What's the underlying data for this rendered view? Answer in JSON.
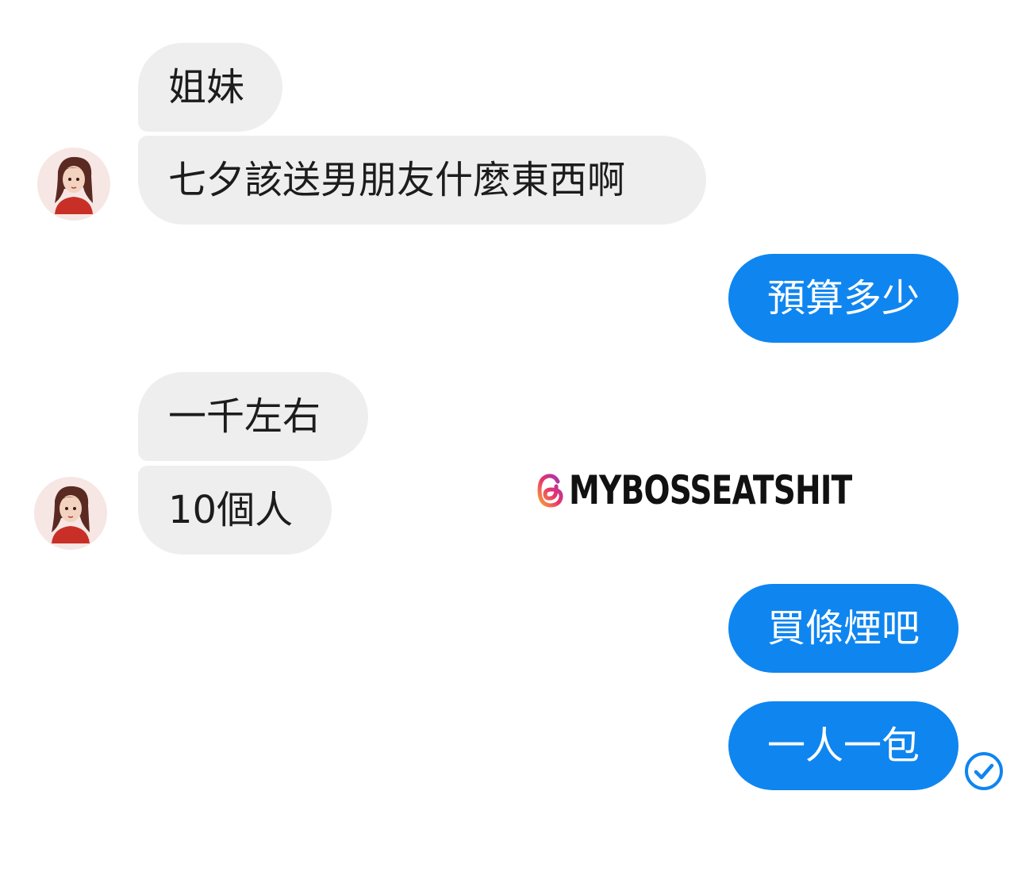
{
  "messages": [
    {
      "side": "incoming",
      "text": "姐妹"
    },
    {
      "side": "incoming",
      "text": "七夕該送男朋友什麼東西啊"
    },
    {
      "side": "outgoing",
      "text": "預算多少"
    },
    {
      "side": "incoming",
      "text": "一千左右"
    },
    {
      "side": "incoming",
      "text": "10個人"
    },
    {
      "side": "outgoing",
      "text": "買條煙吧"
    },
    {
      "side": "outgoing",
      "text": "一人一包"
    }
  ],
  "watermark": {
    "icon": "threads-logo-icon",
    "text": "MYBOSSEATSHIT"
  },
  "status": {
    "icon": "read-receipt-check-icon"
  },
  "colors": {
    "incoming_bubble": "#efeeef",
    "outgoing_bubble": "#0f85f0",
    "read_receipt": "#0f85f0"
  }
}
